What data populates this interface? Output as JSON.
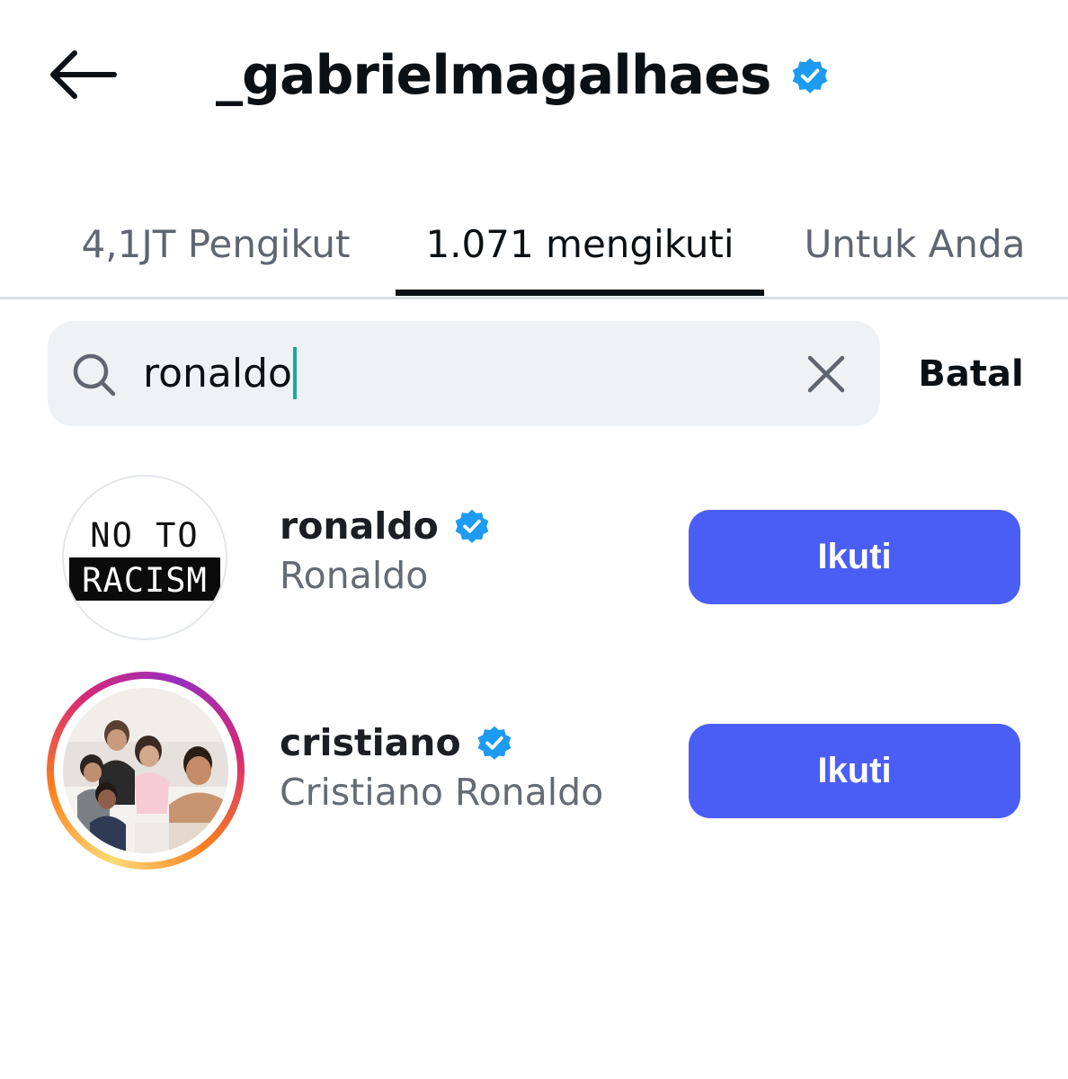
{
  "header": {
    "username": "_gabrielmagalhaes",
    "verified": true
  },
  "tabs": [
    {
      "label": "4,1JT Pengikut",
      "active": false
    },
    {
      "label": "1.071 mengikuti",
      "active": true
    },
    {
      "label": "Untuk Anda",
      "active": false
    }
  ],
  "search": {
    "value": "ronaldo",
    "cancel_label": "Batal"
  },
  "results": [
    {
      "username": "ronaldo",
      "full_name": "Ronaldo",
      "verified": true,
      "has_story": false,
      "avatar_text_top": "NO TO",
      "avatar_text_bottom": "RACISM",
      "follow_label": "Ikuti"
    },
    {
      "username": "cristiano",
      "full_name": "Cristiano Ronaldo",
      "verified": true,
      "has_story": true,
      "follow_label": "Ikuti"
    }
  ],
  "colors": {
    "accent": "#4a5ef5",
    "verified": "#1d9bf0",
    "caret": "#1aa7a0"
  }
}
